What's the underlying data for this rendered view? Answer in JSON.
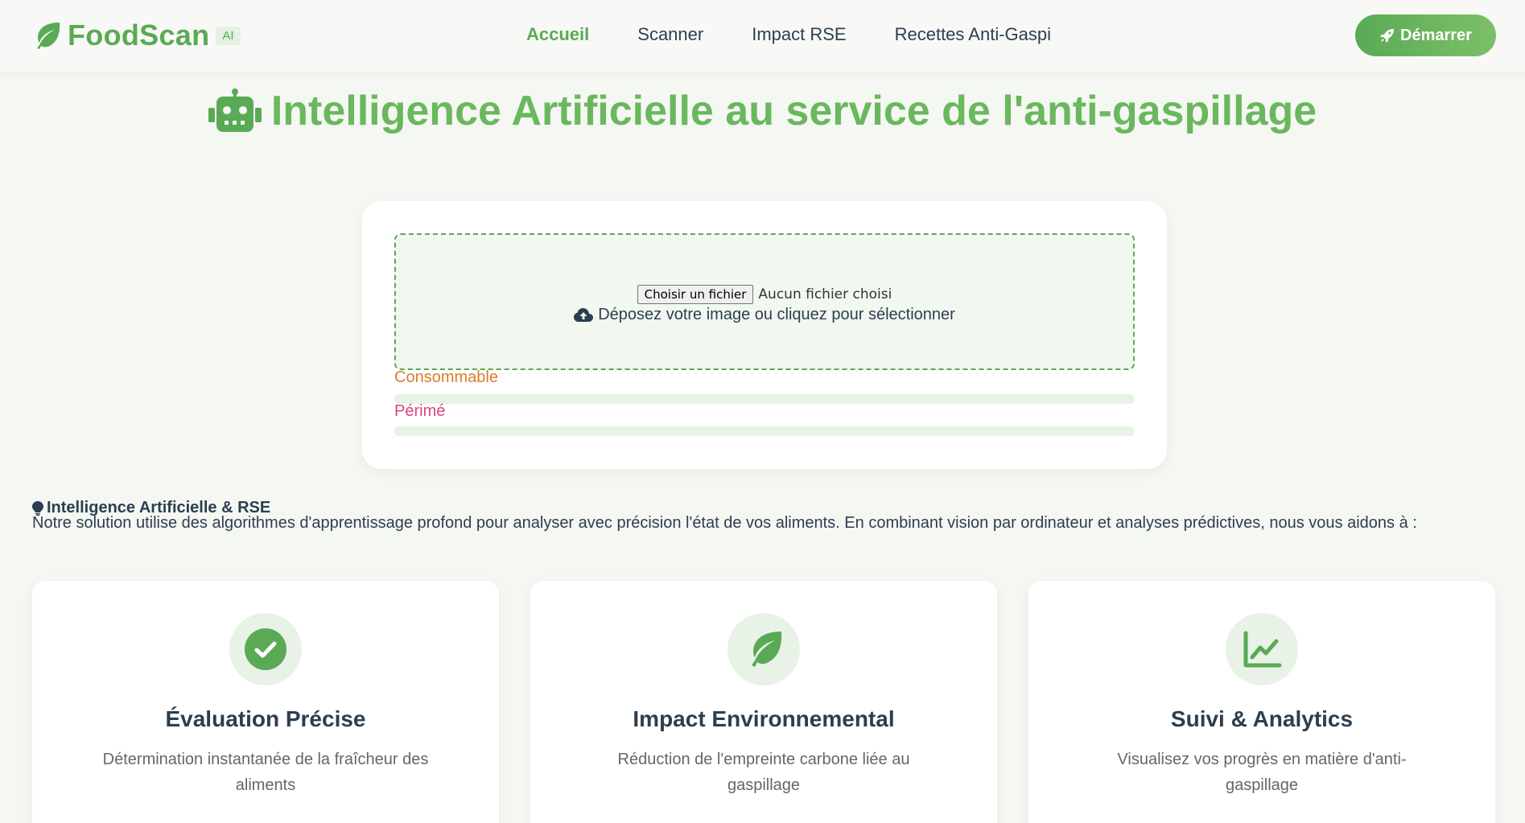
{
  "brand": {
    "name": "FoodScan",
    "badge": "AI",
    "icon": "leaf-icon"
  },
  "nav": {
    "links": [
      {
        "label": "Accueil",
        "active": true
      },
      {
        "label": "Scanner",
        "active": false
      },
      {
        "label": "Impact RSE",
        "active": false
      },
      {
        "label": "Recettes Anti-Gaspi",
        "active": false
      }
    ],
    "start_button": {
      "label": "Démarrer",
      "icon": "rocket-icon"
    }
  },
  "hero": {
    "title": "Intelligence Artificielle au service de l'anti-gaspillage",
    "icon": "robot-icon"
  },
  "upload": {
    "file_button": "Choisir un fichier",
    "file_status": "Aucun fichier choisi",
    "drop_text": "Déposez votre image ou cliquez pour sélectionner",
    "drop_icon": "cloud-upload-icon",
    "results": [
      {
        "label": "Consommable",
        "value": 0,
        "color": "#e07b2c"
      },
      {
        "label": "Périmé",
        "value": 0,
        "color": "#d9467a"
      }
    ]
  },
  "info": {
    "icon": "lightbulb-icon",
    "title": "Intelligence Artificielle & RSE",
    "text": "Notre solution utilise des algorithmes d'apprentissage profond pour analyser avec précision l'état de vos aliments. En combinant vision par ordinateur et analyses prédictives, nous vous aidons à :"
  },
  "features": [
    {
      "icon": "check-circle-icon",
      "title": "Évaluation Précise",
      "desc": "Détermination instantanée de la fraîcheur des aliments"
    },
    {
      "icon": "leaf-icon",
      "title": "Impact Environnemental",
      "desc": "Réduction de l'empreinte carbone liée au gaspillage"
    },
    {
      "icon": "chart-line-icon",
      "title": "Suivi & Analytics",
      "desc": "Visualisez vos progrès en matière d'anti-gaspillage"
    }
  ],
  "colors": {
    "accent": "#5aaa55",
    "hero": "#6ab85d",
    "consumable": "#e07b2c",
    "expired": "#d9467a"
  }
}
